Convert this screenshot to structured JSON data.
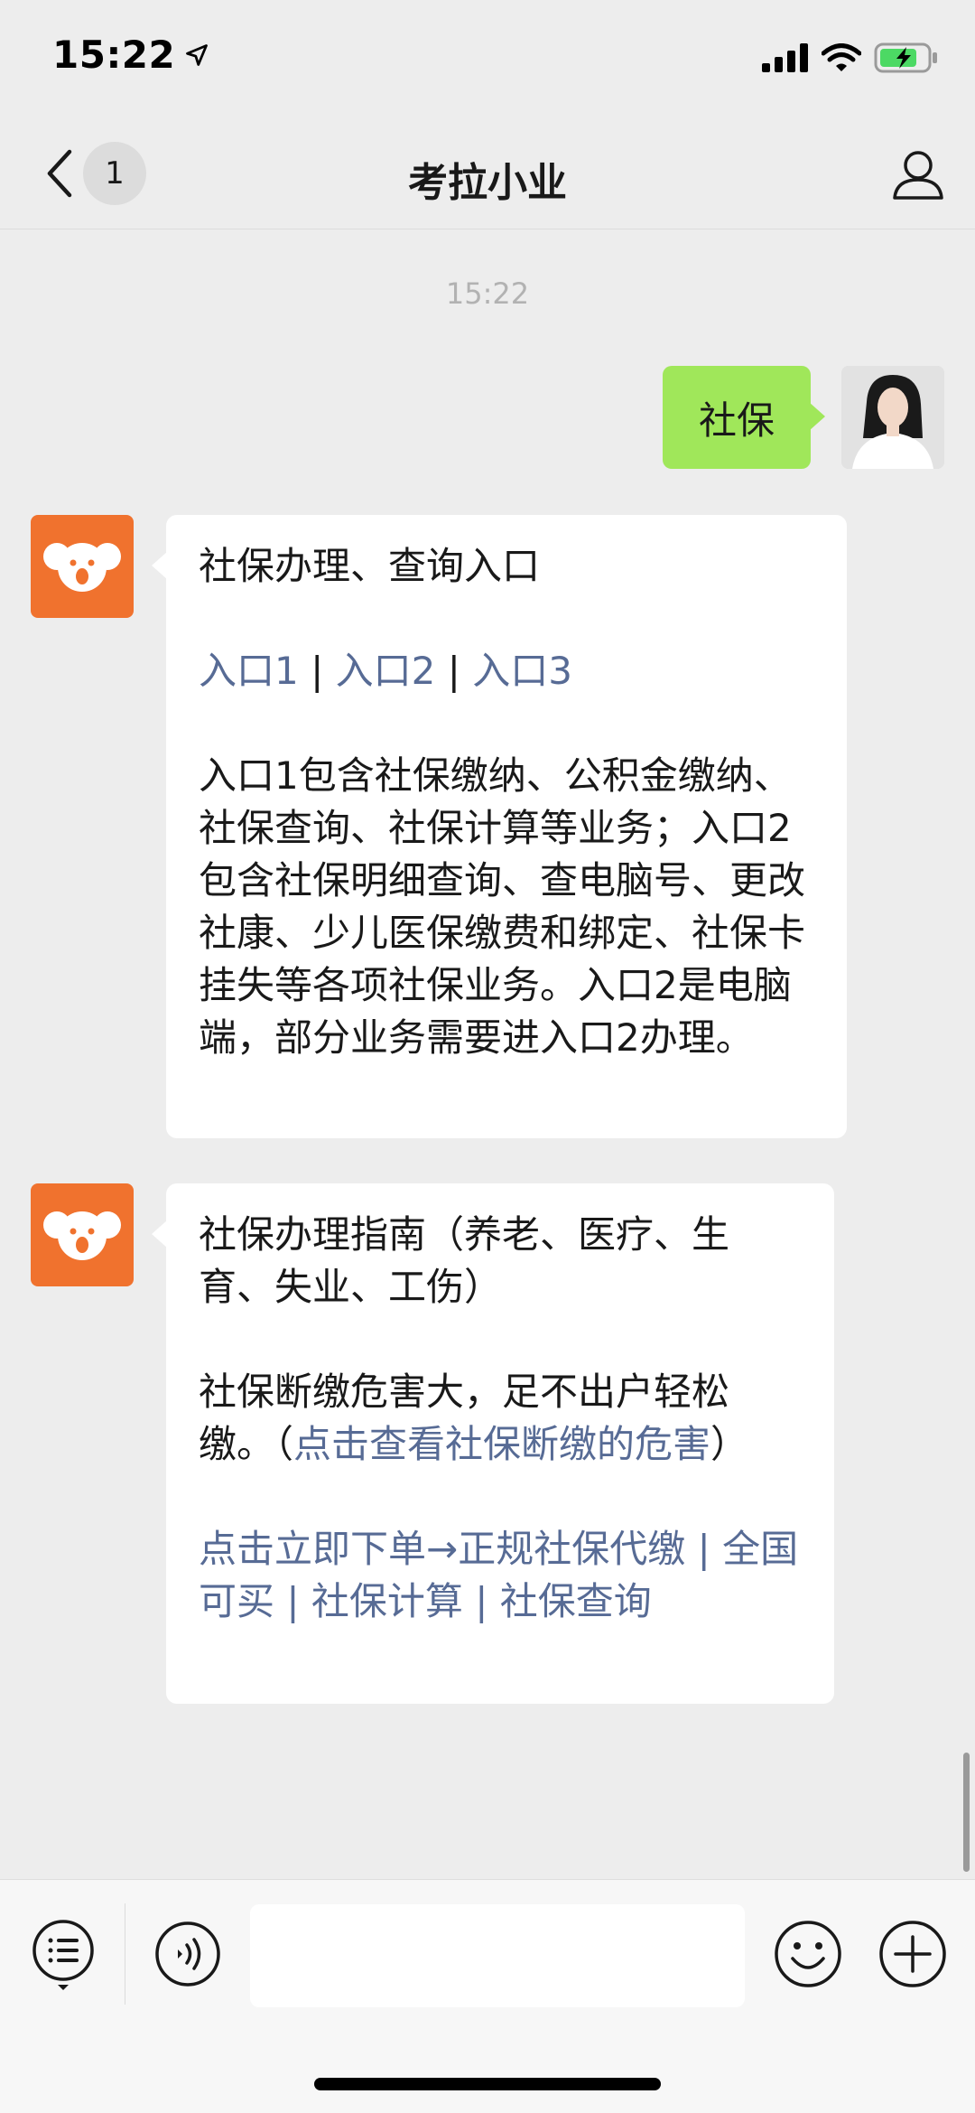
{
  "status_bar": {
    "time": "15:22",
    "icons": [
      "location-arrow-icon",
      "cellular-signal-icon",
      "wifi-icon",
      "battery-charging-icon"
    ]
  },
  "nav": {
    "back_icon": "chevron-left-icon",
    "unread_count": "1",
    "title": "考拉小业",
    "profile_icon": "person-icon"
  },
  "chat": {
    "timestamp": "15:22",
    "messages": [
      {
        "direction": "sent",
        "text": "社保"
      },
      {
        "direction": "received",
        "title": "社保办理、查询入口",
        "links": [
          "入口1",
          "入口2",
          "入口3"
        ],
        "link_separator": "|",
        "body": "入口1包含社保缴纳、公积金缴纳、社保查询、社保计算等业务；入口2包含社保明细查询、查电脑号、更改社康、少儿医保缴费和绑定、社保卡挂失等各项社保业务。入口2是电脑端，部分业务需要进入口2办理。"
      },
      {
        "direction": "received",
        "title": "社保办理指南（养老、医疗、生育、失业、工伤）",
        "body_prefix": " 社保断缴危害大，足不出户轻松缴。（",
        "body_link": "点击查看社保断缴的危害",
        "body_suffix": "）",
        "links": [
          "点击立即下单→正规社保代缴",
          "全国可买",
          "社保计算",
          "社保查询"
        ],
        "link_separator": "|"
      }
    ]
  },
  "toolbar": {
    "icons": [
      "menu-list-icon",
      "voice-icon",
      "emoji-icon",
      "plus-icon"
    ],
    "input_value": ""
  },
  "colors": {
    "background": "#ededed",
    "sent_bubble": "#a0e75a",
    "received_bubble": "#ffffff",
    "link": "#576b95",
    "brand_orange": "#f0722e"
  }
}
